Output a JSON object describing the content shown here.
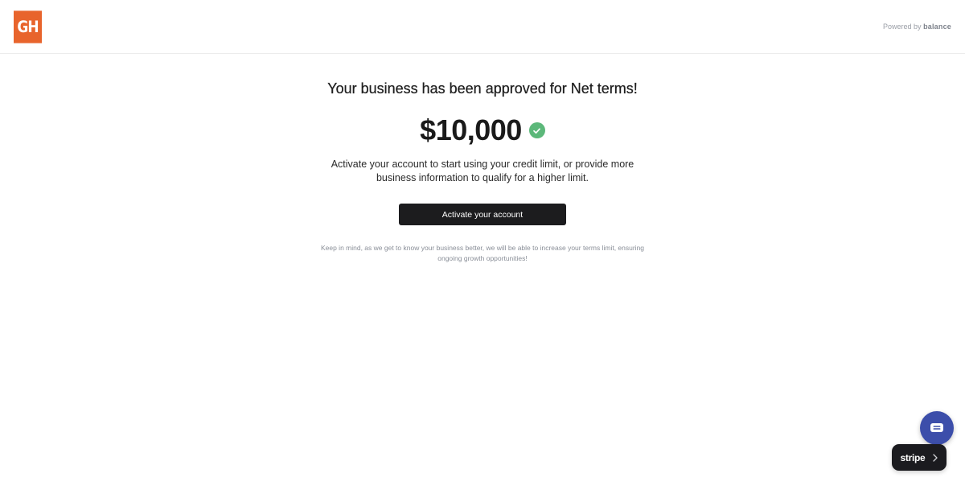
{
  "header": {
    "logo_text": "GH",
    "powered_prefix": "Powered by",
    "powered_brand": "balance"
  },
  "main": {
    "title": "Your business has been approved for Net terms!",
    "amount": "$10,000",
    "description": "Activate your account to start using your credit limit, or provide more business information to qualify for a higher limit.",
    "cta_label": "Activate your account",
    "note": "Keep in mind, as we get to know your business better, we will be able to increase your terms limit, ensuring ongoing growth opportunities!"
  },
  "widgets": {
    "stripe_label": "stripe",
    "chat_icon": "chat-bubble-icon",
    "chevron_icon": "chevron-right-icon"
  },
  "colors": {
    "logo_bg": "#e8642c",
    "success": "#5cb87a",
    "button_bg": "#1c1c1e",
    "chat_bg": "#3c4eaa"
  }
}
